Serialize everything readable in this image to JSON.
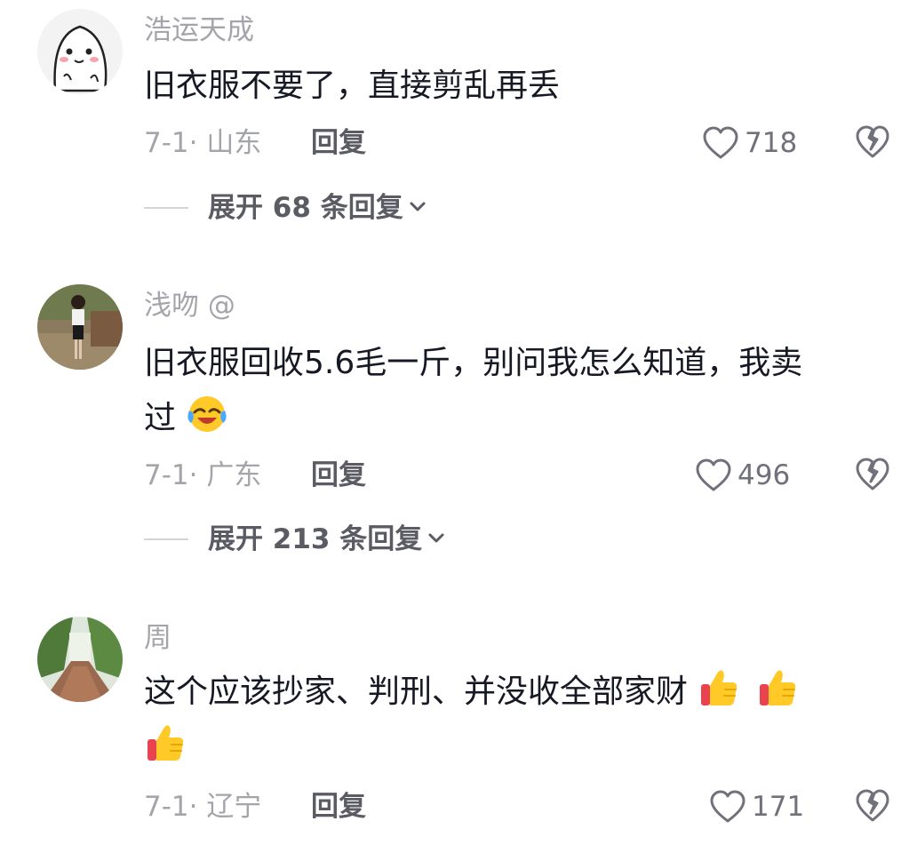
{
  "comments": [
    {
      "username": "浩运天成",
      "content": "旧衣服不要了，直接剪乱再丢",
      "date": "7-1·",
      "location": "山东",
      "reply_label": "回复",
      "likes": "718",
      "expand_label": "展开 68 条回复"
    },
    {
      "username": "浅吻 @",
      "content_line1": "旧衣服回收5.6毛一斤，别问我怎么知道，我卖",
      "content_line2": "过",
      "emoji": "laughing-crying-emoji",
      "date": "7-1·",
      "location": "广东",
      "reply_label": "回复",
      "likes": "496",
      "expand_label": "展开 213 条回复"
    },
    {
      "username": "周",
      "content_line1": "这个应该抄家、判刑、并没收全部家财",
      "emoji": "thumbs-up-emoji",
      "date": "7-1·",
      "location": "辽宁",
      "reply_label": "回复",
      "likes": "171"
    }
  ],
  "colors": {
    "text_primary": "#161823",
    "text_secondary": "#a4a5aa",
    "text_action": "#5b5c63",
    "divider": "#d4d5d9"
  },
  "icons": [
    "heart-outline-icon",
    "broken-heart-icon",
    "chevron-down-icon"
  ]
}
